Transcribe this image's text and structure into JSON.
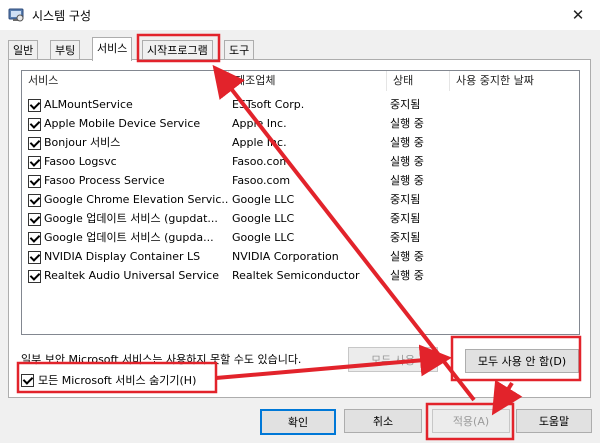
{
  "window": {
    "title": "시스템 구성"
  },
  "tabs": [
    {
      "label": "일반"
    },
    {
      "label": "부팅"
    },
    {
      "label": "서비스",
      "active": true
    },
    {
      "label": "시작프로그램"
    },
    {
      "label": "도구"
    }
  ],
  "services_table": {
    "columns": [
      "서비스",
      "제조업체",
      "상태",
      "사용 중지한 날짜"
    ],
    "rows": [
      {
        "checked": true,
        "name": "ALMountService",
        "manufacturer": "ESTsoft Corp.",
        "status": "중지됨"
      },
      {
        "checked": true,
        "name": "Apple Mobile Device Service",
        "manufacturer": "Apple Inc.",
        "status": "실행 중"
      },
      {
        "checked": true,
        "name": "Bonjour 서비스",
        "manufacturer": "Apple Inc.",
        "status": "실행 중"
      },
      {
        "checked": true,
        "name": "Fasoo Logsvc",
        "manufacturer": "Fasoo.com",
        "status": "실행 중"
      },
      {
        "checked": true,
        "name": "Fasoo Process Service",
        "manufacturer": "Fasoo.com",
        "status": "실행 중"
      },
      {
        "checked": true,
        "name": "Google Chrome Elevation Servic...",
        "manufacturer": "Google LLC",
        "status": "중지됨"
      },
      {
        "checked": true,
        "name": "Google 업데이트 서비스 (gupdat...",
        "manufacturer": "Google LLC",
        "status": "중지됨"
      },
      {
        "checked": true,
        "name": "Google 업데이트 서비스 (gupda...",
        "manufacturer": "Google LLC",
        "status": "중지됨"
      },
      {
        "checked": true,
        "name": "NVIDIA Display Container LS",
        "manufacturer": "NVIDIA Corporation",
        "status": "실행 중"
      },
      {
        "checked": true,
        "name": "Realtek Audio Universal Service",
        "manufacturer": "Realtek Semiconductor",
        "status": "실행 중"
      }
    ]
  },
  "note_text": "일부 보안 Microsoft 서비스는 사용하지 못할 수도 있습니다.",
  "enable_all_label": "모두 사용",
  "disable_all_label": "모두 사용 안 함(D)",
  "hide_microsoft_label": "모든 Microsoft 서비스 숨기기(H)",
  "hide_microsoft_checked": true,
  "footer": {
    "ok_label": "확인",
    "cancel_label": "취소",
    "apply_label": "적용(A)",
    "help_label": "도움말"
  },
  "colors": {
    "annotation": "#e2232b",
    "focus_blue": "#0078d7"
  },
  "icons": {
    "app": "msconfig-icon",
    "close": "close-icon",
    "check": "checkmark-icon"
  }
}
